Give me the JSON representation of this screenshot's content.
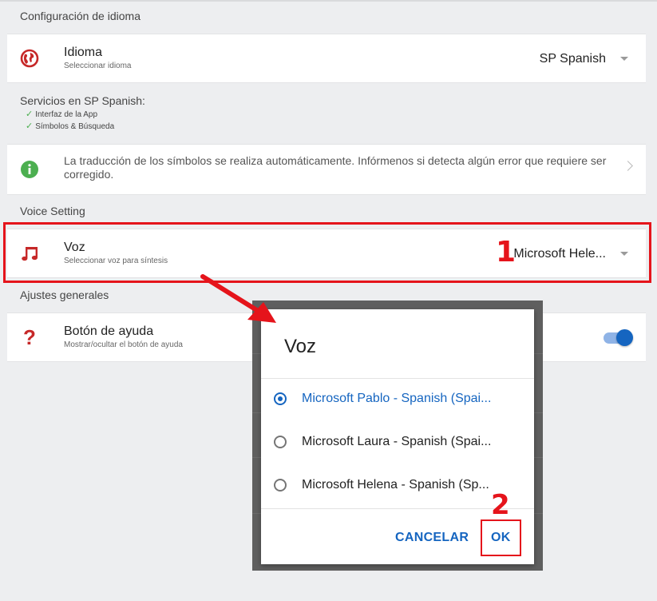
{
  "language_section": {
    "title": "Configuración de idioma",
    "row": {
      "title": "Idioma",
      "subtitle": "Seleccionar idioma",
      "value": "SP Spanish"
    }
  },
  "services": {
    "title": "Servicios en SP Spanish:",
    "items": [
      "Interfaz de la App",
      "Símbolos & Búsqueda"
    ]
  },
  "info_card": {
    "text": "La traducción de los símbolos se realiza automáticamente. Infórmenos si detecta algún error que requiere ser corregido."
  },
  "voice_section": {
    "title": "Voice Setting",
    "row": {
      "title": "Voz",
      "subtitle": "Seleccionar voz para síntesis",
      "value": "Microsoft Hele..."
    }
  },
  "general_section": {
    "title": "Ajustes generales",
    "row": {
      "title": "Botón de ayuda",
      "subtitle": "Mostrar/ocultar el botón de ayuda",
      "toggle_on": true
    }
  },
  "annotations": {
    "step1": "1",
    "step2": "2"
  },
  "dialog": {
    "title": "Voz",
    "options": [
      {
        "label": "Microsoft Pablo - Spanish (Spai...",
        "selected": true
      },
      {
        "label": "Microsoft Laura - Spanish (Spai...",
        "selected": false
      },
      {
        "label": "Microsoft Helena - Spanish (Sp...",
        "selected": false
      }
    ],
    "cancel_label": "CANCELAR",
    "ok_label": "OK"
  },
  "colors": {
    "accent": "#1565c0",
    "annotation_red": "#e5141b",
    "icon_red": "#c62828",
    "success_green": "#4caf50"
  }
}
